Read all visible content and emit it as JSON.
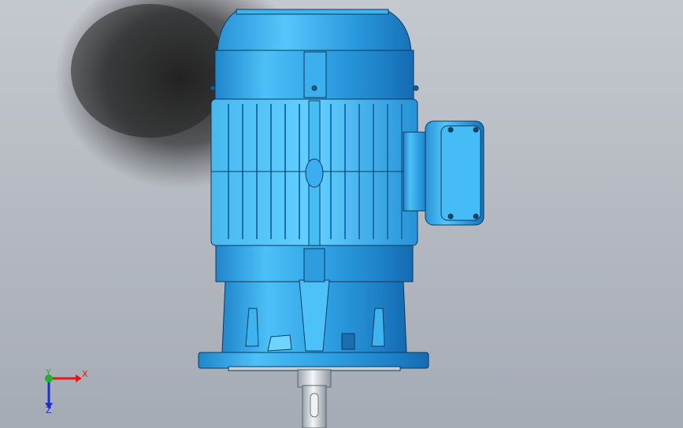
{
  "viewport": {
    "background_top": "#c4c8cf",
    "background_bottom": "#a5abb4"
  },
  "model": {
    "name": "motor-assembly",
    "primary_color": "#2d9de0",
    "highlight_color": "#5cc8ff",
    "shadow_color": "#1476bd",
    "edge_color": "#0e3a5c",
    "shaft_color": "#dfe3e8"
  },
  "triad": {
    "x_label": "X",
    "y_label": "Y",
    "z_label": "Z",
    "x_color": "#e0191a",
    "y_color": "#1fb32a",
    "z_color": "#1a2fd6"
  }
}
